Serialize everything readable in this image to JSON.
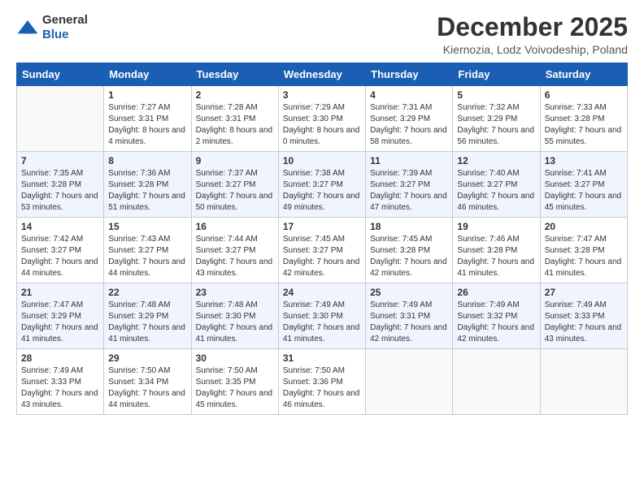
{
  "header": {
    "logo_general": "General",
    "logo_blue": "Blue",
    "title": "December 2025",
    "subtitle": "Kiernozia, Lodz Voivodeship, Poland"
  },
  "calendar": {
    "weekdays": [
      "Sunday",
      "Monday",
      "Tuesday",
      "Wednesday",
      "Thursday",
      "Friday",
      "Saturday"
    ],
    "weeks": [
      [
        {
          "day": "",
          "sunrise": "",
          "sunset": "",
          "daylight": ""
        },
        {
          "day": "1",
          "sunrise": "Sunrise: 7:27 AM",
          "sunset": "Sunset: 3:31 PM",
          "daylight": "Daylight: 8 hours and 4 minutes."
        },
        {
          "day": "2",
          "sunrise": "Sunrise: 7:28 AM",
          "sunset": "Sunset: 3:31 PM",
          "daylight": "Daylight: 8 hours and 2 minutes."
        },
        {
          "day": "3",
          "sunrise": "Sunrise: 7:29 AM",
          "sunset": "Sunset: 3:30 PM",
          "daylight": "Daylight: 8 hours and 0 minutes."
        },
        {
          "day": "4",
          "sunrise": "Sunrise: 7:31 AM",
          "sunset": "Sunset: 3:29 PM",
          "daylight": "Daylight: 7 hours and 58 minutes."
        },
        {
          "day": "5",
          "sunrise": "Sunrise: 7:32 AM",
          "sunset": "Sunset: 3:29 PM",
          "daylight": "Daylight: 7 hours and 56 minutes."
        },
        {
          "day": "6",
          "sunrise": "Sunrise: 7:33 AM",
          "sunset": "Sunset: 3:28 PM",
          "daylight": "Daylight: 7 hours and 55 minutes."
        }
      ],
      [
        {
          "day": "7",
          "sunrise": "Sunrise: 7:35 AM",
          "sunset": "Sunset: 3:28 PM",
          "daylight": "Daylight: 7 hours and 53 minutes."
        },
        {
          "day": "8",
          "sunrise": "Sunrise: 7:36 AM",
          "sunset": "Sunset: 3:28 PM",
          "daylight": "Daylight: 7 hours and 51 minutes."
        },
        {
          "day": "9",
          "sunrise": "Sunrise: 7:37 AM",
          "sunset": "Sunset: 3:27 PM",
          "daylight": "Daylight: 7 hours and 50 minutes."
        },
        {
          "day": "10",
          "sunrise": "Sunrise: 7:38 AM",
          "sunset": "Sunset: 3:27 PM",
          "daylight": "Daylight: 7 hours and 49 minutes."
        },
        {
          "day": "11",
          "sunrise": "Sunrise: 7:39 AM",
          "sunset": "Sunset: 3:27 PM",
          "daylight": "Daylight: 7 hours and 47 minutes."
        },
        {
          "day": "12",
          "sunrise": "Sunrise: 7:40 AM",
          "sunset": "Sunset: 3:27 PM",
          "daylight": "Daylight: 7 hours and 46 minutes."
        },
        {
          "day": "13",
          "sunrise": "Sunrise: 7:41 AM",
          "sunset": "Sunset: 3:27 PM",
          "daylight": "Daylight: 7 hours and 45 minutes."
        }
      ],
      [
        {
          "day": "14",
          "sunrise": "Sunrise: 7:42 AM",
          "sunset": "Sunset: 3:27 PM",
          "daylight": "Daylight: 7 hours and 44 minutes."
        },
        {
          "day": "15",
          "sunrise": "Sunrise: 7:43 AM",
          "sunset": "Sunset: 3:27 PM",
          "daylight": "Daylight: 7 hours and 44 minutes."
        },
        {
          "day": "16",
          "sunrise": "Sunrise: 7:44 AM",
          "sunset": "Sunset: 3:27 PM",
          "daylight": "Daylight: 7 hours and 43 minutes."
        },
        {
          "day": "17",
          "sunrise": "Sunrise: 7:45 AM",
          "sunset": "Sunset: 3:27 PM",
          "daylight": "Daylight: 7 hours and 42 minutes."
        },
        {
          "day": "18",
          "sunrise": "Sunrise: 7:45 AM",
          "sunset": "Sunset: 3:28 PM",
          "daylight": "Daylight: 7 hours and 42 minutes."
        },
        {
          "day": "19",
          "sunrise": "Sunrise: 7:46 AM",
          "sunset": "Sunset: 3:28 PM",
          "daylight": "Daylight: 7 hours and 41 minutes."
        },
        {
          "day": "20",
          "sunrise": "Sunrise: 7:47 AM",
          "sunset": "Sunset: 3:28 PM",
          "daylight": "Daylight: 7 hours and 41 minutes."
        }
      ],
      [
        {
          "day": "21",
          "sunrise": "Sunrise: 7:47 AM",
          "sunset": "Sunset: 3:29 PM",
          "daylight": "Daylight: 7 hours and 41 minutes."
        },
        {
          "day": "22",
          "sunrise": "Sunrise: 7:48 AM",
          "sunset": "Sunset: 3:29 PM",
          "daylight": "Daylight: 7 hours and 41 minutes."
        },
        {
          "day": "23",
          "sunrise": "Sunrise: 7:48 AM",
          "sunset": "Sunset: 3:30 PM",
          "daylight": "Daylight: 7 hours and 41 minutes."
        },
        {
          "day": "24",
          "sunrise": "Sunrise: 7:49 AM",
          "sunset": "Sunset: 3:30 PM",
          "daylight": "Daylight: 7 hours and 41 minutes."
        },
        {
          "day": "25",
          "sunrise": "Sunrise: 7:49 AM",
          "sunset": "Sunset: 3:31 PM",
          "daylight": "Daylight: 7 hours and 42 minutes."
        },
        {
          "day": "26",
          "sunrise": "Sunrise: 7:49 AM",
          "sunset": "Sunset: 3:32 PM",
          "daylight": "Daylight: 7 hours and 42 minutes."
        },
        {
          "day": "27",
          "sunrise": "Sunrise: 7:49 AM",
          "sunset": "Sunset: 3:33 PM",
          "daylight": "Daylight: 7 hours and 43 minutes."
        }
      ],
      [
        {
          "day": "28",
          "sunrise": "Sunrise: 7:49 AM",
          "sunset": "Sunset: 3:33 PM",
          "daylight": "Daylight: 7 hours and 43 minutes."
        },
        {
          "day": "29",
          "sunrise": "Sunrise: 7:50 AM",
          "sunset": "Sunset: 3:34 PM",
          "daylight": "Daylight: 7 hours and 44 minutes."
        },
        {
          "day": "30",
          "sunrise": "Sunrise: 7:50 AM",
          "sunset": "Sunset: 3:35 PM",
          "daylight": "Daylight: 7 hours and 45 minutes."
        },
        {
          "day": "31",
          "sunrise": "Sunrise: 7:50 AM",
          "sunset": "Sunset: 3:36 PM",
          "daylight": "Daylight: 7 hours and 46 minutes."
        },
        {
          "day": "",
          "sunrise": "",
          "sunset": "",
          "daylight": ""
        },
        {
          "day": "",
          "sunrise": "",
          "sunset": "",
          "daylight": ""
        },
        {
          "day": "",
          "sunrise": "",
          "sunset": "",
          "daylight": ""
        }
      ]
    ]
  }
}
